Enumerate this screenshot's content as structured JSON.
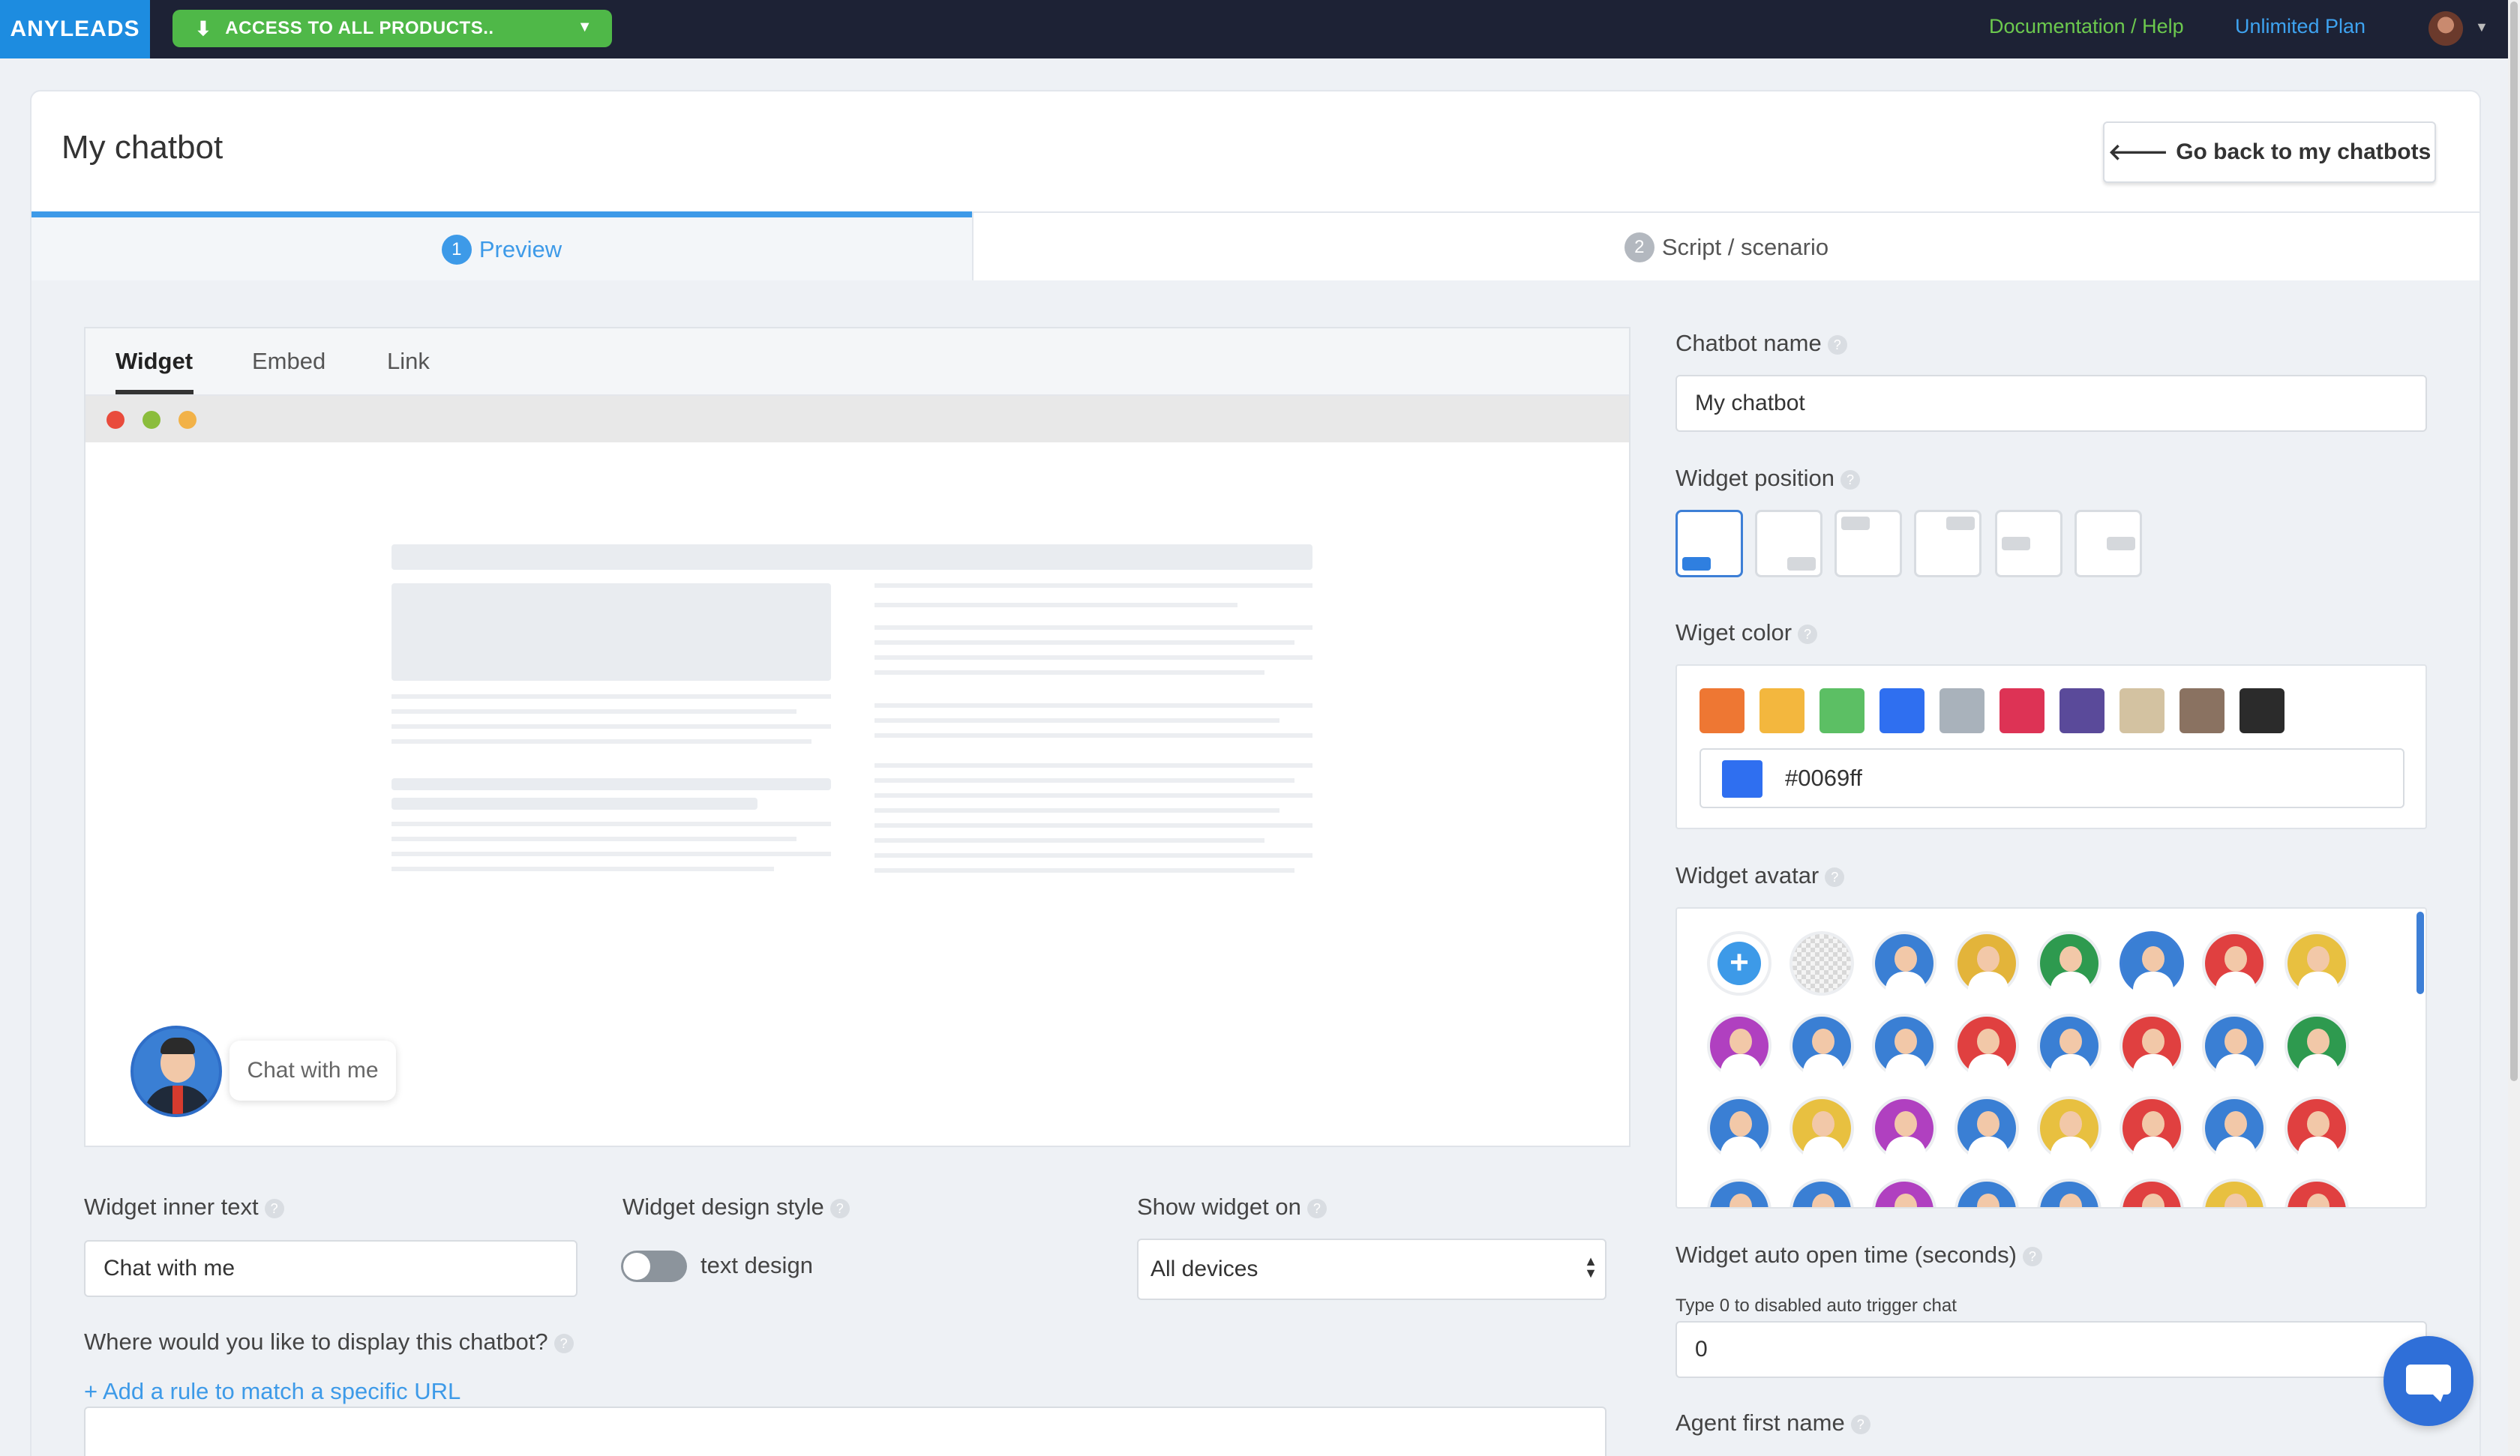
{
  "topbar": {
    "logo": "ANYLEADS",
    "access_label": "ACCESS TO ALL PRODUCTS..",
    "doc_link": "Documentation / Help",
    "plan_link": "Unlimited Plan"
  },
  "header": {
    "title": "My chatbot",
    "back_label": "Go back to my chatbots"
  },
  "steps": [
    {
      "num": "1",
      "label": "Preview",
      "active": true
    },
    {
      "num": "2",
      "label": "Script / scenario",
      "active": false
    }
  ],
  "preview": {
    "tabs": [
      "Widget",
      "Embed",
      "Link"
    ],
    "active_tab": "Widget",
    "bubble_text": "Chat with me"
  },
  "form": {
    "inner_text_label": "Widget inner text",
    "inner_text_value": "Chat with me",
    "design_style_label": "Widget design style",
    "design_toggle_label": "text design",
    "show_on_label": "Show widget on",
    "show_on_value": "All devices",
    "display_label": "Where would you like to display this chatbot?",
    "add_rule_link": "+ Add a rule to match a specific URL"
  },
  "settings": {
    "name_label": "Chatbot name",
    "name_value": "My chatbot",
    "position_label": "Widget position",
    "color_label": "Wiget color",
    "swatches": [
      "#ee7733",
      "#f3b73e",
      "#5cbf64",
      "#2f6ff0",
      "#a9b2bb",
      "#dd3355",
      "#5a4a9a",
      "#d3c2a1",
      "#8a7261",
      "#2b2b2b"
    ],
    "hex_value": "#0069ff",
    "avatar_label": "Widget avatar",
    "auto_open_label": "Widget auto open time (seconds)",
    "auto_open_hint": "Type 0 to disabled auto trigger chat",
    "auto_open_value": "0",
    "agent_first_name_label": "Agent first name"
  }
}
